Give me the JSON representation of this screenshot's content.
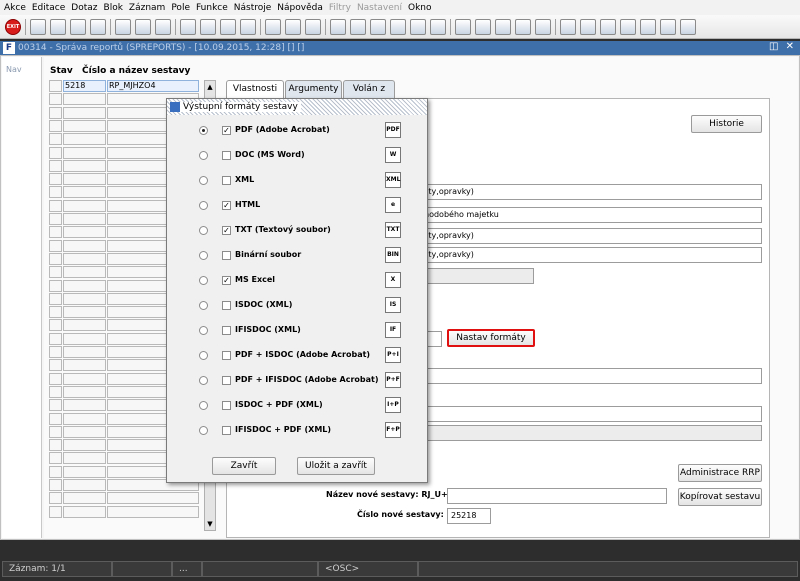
{
  "menu": [
    "Akce",
    "Editace",
    "Dotaz",
    "Blok",
    "Záznam",
    "Pole",
    "Funkce",
    "Nástroje",
    "Nápověda",
    "Filtry",
    "Nastavení",
    "Okno"
  ],
  "menu_disabled": [
    "Filtry",
    "Nastavení"
  ],
  "window": {
    "title": "00314 - Správa reportů (SPREPORTS) - [10.09.2015, 12:28] [] []",
    "controls": "◫ ✕"
  },
  "nav": {
    "label": "Nav"
  },
  "grid": {
    "col_stav": "Stav",
    "col_name": "Číslo a název sestavy",
    "first_row": {
      "number": "5218",
      "name": "RP_MJHZO4"
    }
  },
  "tabs": [
    "Vlastnosti",
    "Argumenty",
    "Volán z"
  ],
  "form": {
    "historie_button": "Historie",
    "fields": [
      "čty,opravky)",
      "hodobého majetku",
      "čty,opravky)",
      "čty,opravky)"
    ],
    "nastav_formaty_button": "Nastav formáty",
    "administrace_button": "Administrace RRP",
    "new_name_label": "Název nové sestavy: RJ_U+",
    "new_name_value": "",
    "kopirovat_button": "Kopírovat sestavu",
    "new_number_label": "Číslo nové sestavy:",
    "new_number_value": "25218"
  },
  "dialog": {
    "title": "Výstupní formáty sestavy",
    "formats": [
      {
        "label": "PDF (Adobe Acrobat)",
        "checked": true,
        "selected": true,
        "icon": "pdf-icon",
        "glyph": "PDF"
      },
      {
        "label": "DOC (MS Word)",
        "checked": false,
        "selected": false,
        "icon": "word-icon",
        "glyph": "W"
      },
      {
        "label": "XML",
        "checked": false,
        "selected": false,
        "icon": "xml-icon",
        "glyph": "XML"
      },
      {
        "label": "HTML",
        "checked": true,
        "selected": false,
        "icon": "html-icon",
        "glyph": "e"
      },
      {
        "label": "TXT (Textový soubor)",
        "checked": true,
        "selected": false,
        "icon": "txt-icon",
        "glyph": "TXT"
      },
      {
        "label": "Binární soubor",
        "checked": false,
        "selected": false,
        "icon": "binary-icon",
        "glyph": "BIN"
      },
      {
        "label": "MS Excel",
        "checked": true,
        "selected": false,
        "icon": "excel-icon",
        "glyph": "X"
      },
      {
        "label": "ISDOC (XML)",
        "checked": false,
        "selected": false,
        "icon": "isdoc-icon",
        "glyph": "IS"
      },
      {
        "label": "IFISDOC (XML)",
        "checked": false,
        "selected": false,
        "icon": "ifisdoc-icon",
        "glyph": "IF"
      },
      {
        "label": "PDF + ISDOC (Adobe Acrobat)",
        "checked": false,
        "selected": false,
        "icon": "pdf-isdoc-icon",
        "glyph": "P+I"
      },
      {
        "label": "PDF + IFISDOC (Adobe Acrobat)",
        "checked": false,
        "selected": false,
        "icon": "pdf-ifisdoc-icon",
        "glyph": "P+F"
      },
      {
        "label": "ISDOC + PDF (XML)",
        "checked": false,
        "selected": false,
        "icon": "isdoc-pdf-icon",
        "glyph": "I+P"
      },
      {
        "label": "IFISDOC + PDF (XML)",
        "checked": false,
        "selected": false,
        "icon": "ifisdoc-pdf-icon",
        "glyph": "F+P"
      }
    ],
    "close_button": "Zavřít",
    "save_close_button": "Uložit a zavřít"
  },
  "status": {
    "record": "Záznam: 1/1",
    "dots": "...",
    "mode": "<OSC>"
  },
  "colors": {
    "title_bar": "#3f6fa8",
    "highlight_border": "#e01010"
  }
}
